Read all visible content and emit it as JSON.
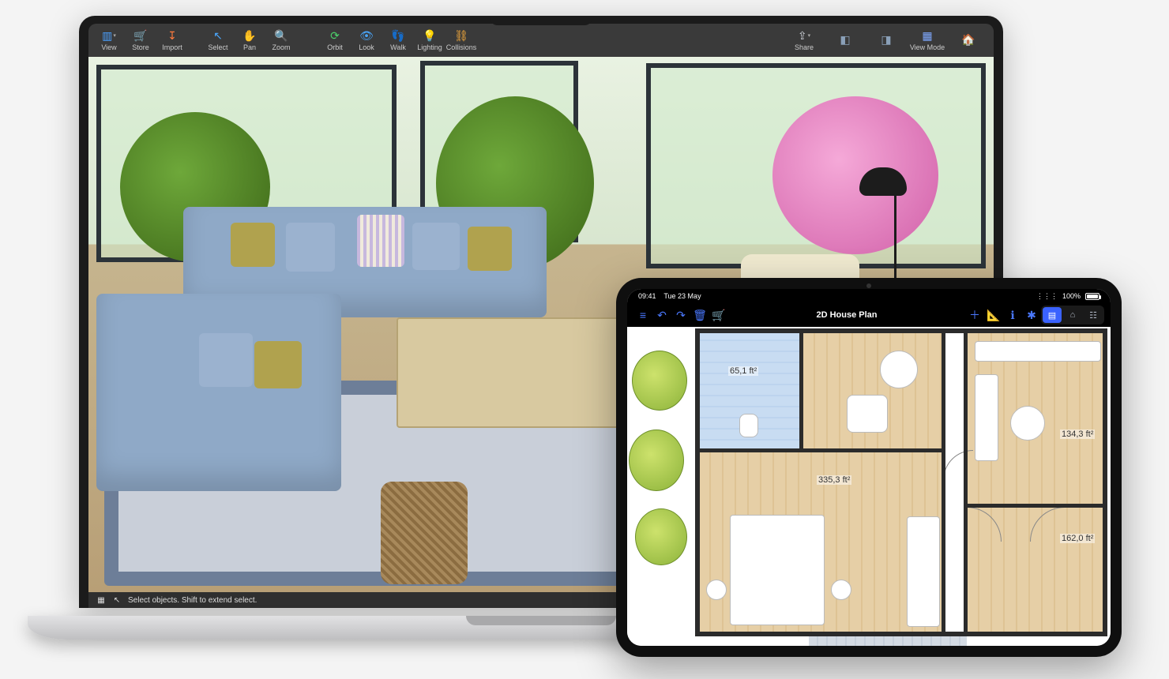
{
  "mac": {
    "toolbar": {
      "left": [
        {
          "id": "view",
          "label": "View",
          "icon": "▥",
          "dropdown": true,
          "color": "#49a0ff"
        },
        {
          "id": "store",
          "label": "Store",
          "icon": "🛒",
          "color": "#3cd070"
        },
        {
          "id": "import",
          "label": "Import",
          "icon": "↧",
          "color": "#ff7a3c"
        }
      ],
      "tools": [
        {
          "id": "select",
          "label": "Select",
          "icon": "↖",
          "color": "#4aa8ff"
        },
        {
          "id": "pan",
          "label": "Pan",
          "icon": "✋",
          "color": "#ffa640"
        },
        {
          "id": "zoom",
          "label": "Zoom",
          "icon": "🔍",
          "color": "#4aa8ff"
        }
      ],
      "nav": [
        {
          "id": "orbit",
          "label": "Orbit",
          "icon": "⟳",
          "color": "#4cd06a"
        },
        {
          "id": "look",
          "label": "Look",
          "icon": "👁",
          "color": "#4aa8ff"
        },
        {
          "id": "walk",
          "label": "Walk",
          "icon": "👣",
          "color": "#7bd0ff"
        },
        {
          "id": "lighting",
          "label": "Lighting",
          "icon": "💡",
          "color": "#ffd23c"
        },
        {
          "id": "collisions",
          "label": "Collisions",
          "icon": "⛓",
          "color": "#ffb03c"
        }
      ],
      "right": [
        {
          "id": "share",
          "label": "Share",
          "icon": "⇪",
          "dropdown": true,
          "color": "#cfd3da"
        },
        {
          "id": "r1",
          "label": "",
          "icon": "◧",
          "color": "#8aa0b8"
        },
        {
          "id": "r2",
          "label": "",
          "icon": "◨",
          "color": "#8aa0b8"
        },
        {
          "id": "viewmode",
          "label": "View Mode",
          "icon": "▦",
          "color": "#7fa9ff"
        },
        {
          "id": "r3",
          "label": "",
          "icon": "🏠",
          "color": "#ff8b3c"
        }
      ]
    },
    "hint": "Select objects. Shift to extend select."
  },
  "ipad": {
    "status": {
      "time": "09:41",
      "date": "Tue 23 May",
      "battery": "100%"
    },
    "title": "2D House Plan",
    "nav_left": [
      {
        "id": "menu",
        "icon": "≡"
      },
      {
        "id": "undo",
        "icon": "↶"
      },
      {
        "id": "redo",
        "icon": "↷"
      },
      {
        "id": "delete",
        "icon": "🗑"
      },
      {
        "id": "store",
        "icon": "🛒"
      }
    ],
    "nav_right": [
      {
        "id": "add",
        "icon": "＋"
      },
      {
        "id": "measure",
        "icon": "📐"
      },
      {
        "id": "info",
        "icon": "ℹ"
      },
      {
        "id": "snap",
        "icon": "✱"
      }
    ],
    "segments": [
      {
        "id": "2d",
        "icon": "▤",
        "active": true
      },
      {
        "id": "3d",
        "icon": "⌂",
        "active": false
      },
      {
        "id": "elev",
        "icon": "☷",
        "active": false
      }
    ],
    "rooms": {
      "bath": "65,1 ft²",
      "living": "335,3 ft²",
      "office": "134,3 ft²",
      "bed2": "162,0 ft²"
    }
  }
}
